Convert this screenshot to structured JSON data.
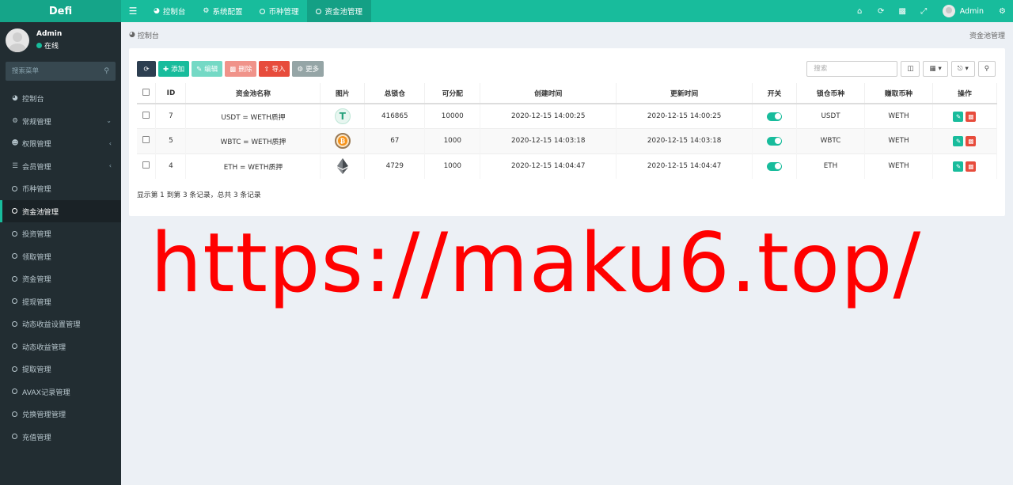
{
  "app": {
    "logo": "Defi"
  },
  "topnav": {
    "tabs": [
      {
        "label": "控制台",
        "icon": "dashboard-icon"
      },
      {
        "label": "系统配置",
        "icon": "gear-icon"
      },
      {
        "label": "币种管理",
        "icon": "circle-icon"
      },
      {
        "label": "资金池管理",
        "icon": "circle-icon",
        "active": true
      }
    ],
    "user": "Admin"
  },
  "sidebar": {
    "user": {
      "name": "Admin",
      "status": "在线"
    },
    "search_placeholder": "搜索菜单",
    "items": [
      {
        "label": "控制台"
      },
      {
        "label": "常规管理"
      },
      {
        "label": "权限管理"
      },
      {
        "label": "会员管理"
      },
      {
        "label": "币种管理"
      },
      {
        "label": "资金池管理"
      },
      {
        "label": "投资管理"
      },
      {
        "label": "领取管理"
      },
      {
        "label": "资金管理"
      },
      {
        "label": "提现管理"
      },
      {
        "label": "动态收益设置管理"
      },
      {
        "label": "动态收益管理"
      },
      {
        "label": "提取管理"
      },
      {
        "label": "AVAX记录管理"
      },
      {
        "label": "兑换管理管理"
      },
      {
        "label": "充值管理"
      }
    ]
  },
  "breadcrumb": {
    "left": "控制台",
    "right": "资金池管理"
  },
  "toolbar": {
    "add": "添加",
    "edit": "编辑",
    "delete": "删除",
    "import": "导入",
    "more": "更多",
    "search_placeholder": "搜索"
  },
  "table": {
    "headers": [
      "ID",
      "资金池名称",
      "图片",
      "总锁仓",
      "可分配",
      "创建时间",
      "更新时间",
      "开关",
      "锁仓币种",
      "赚取币种",
      "操作"
    ],
    "rows": [
      {
        "id": "7",
        "name": "USDT = WETH质押",
        "coin": "USDT",
        "total": "416865",
        "alloc": "10000",
        "created": "2020-12-15 14:00:25",
        "updated": "2020-12-15 14:00:25",
        "lock": "USDT",
        "earn": "WETH"
      },
      {
        "id": "5",
        "name": "WBTC = WETH质押",
        "coin": "BTC",
        "total": "67",
        "alloc": "1000",
        "created": "2020-12-15 14:03:18",
        "updated": "2020-12-15 14:03:18",
        "lock": "WBTC",
        "earn": "WETH"
      },
      {
        "id": "4",
        "name": "ETH = WETH质押",
        "coin": "ETH",
        "total": "4729",
        "alloc": "1000",
        "created": "2020-12-15 14:04:47",
        "updated": "2020-12-15 14:04:47",
        "lock": "ETH",
        "earn": "WETH"
      }
    ],
    "summary": "显示第 1 到第 3 条记录，总共 3 条记录"
  },
  "watermark": "https://maku6.top/"
}
